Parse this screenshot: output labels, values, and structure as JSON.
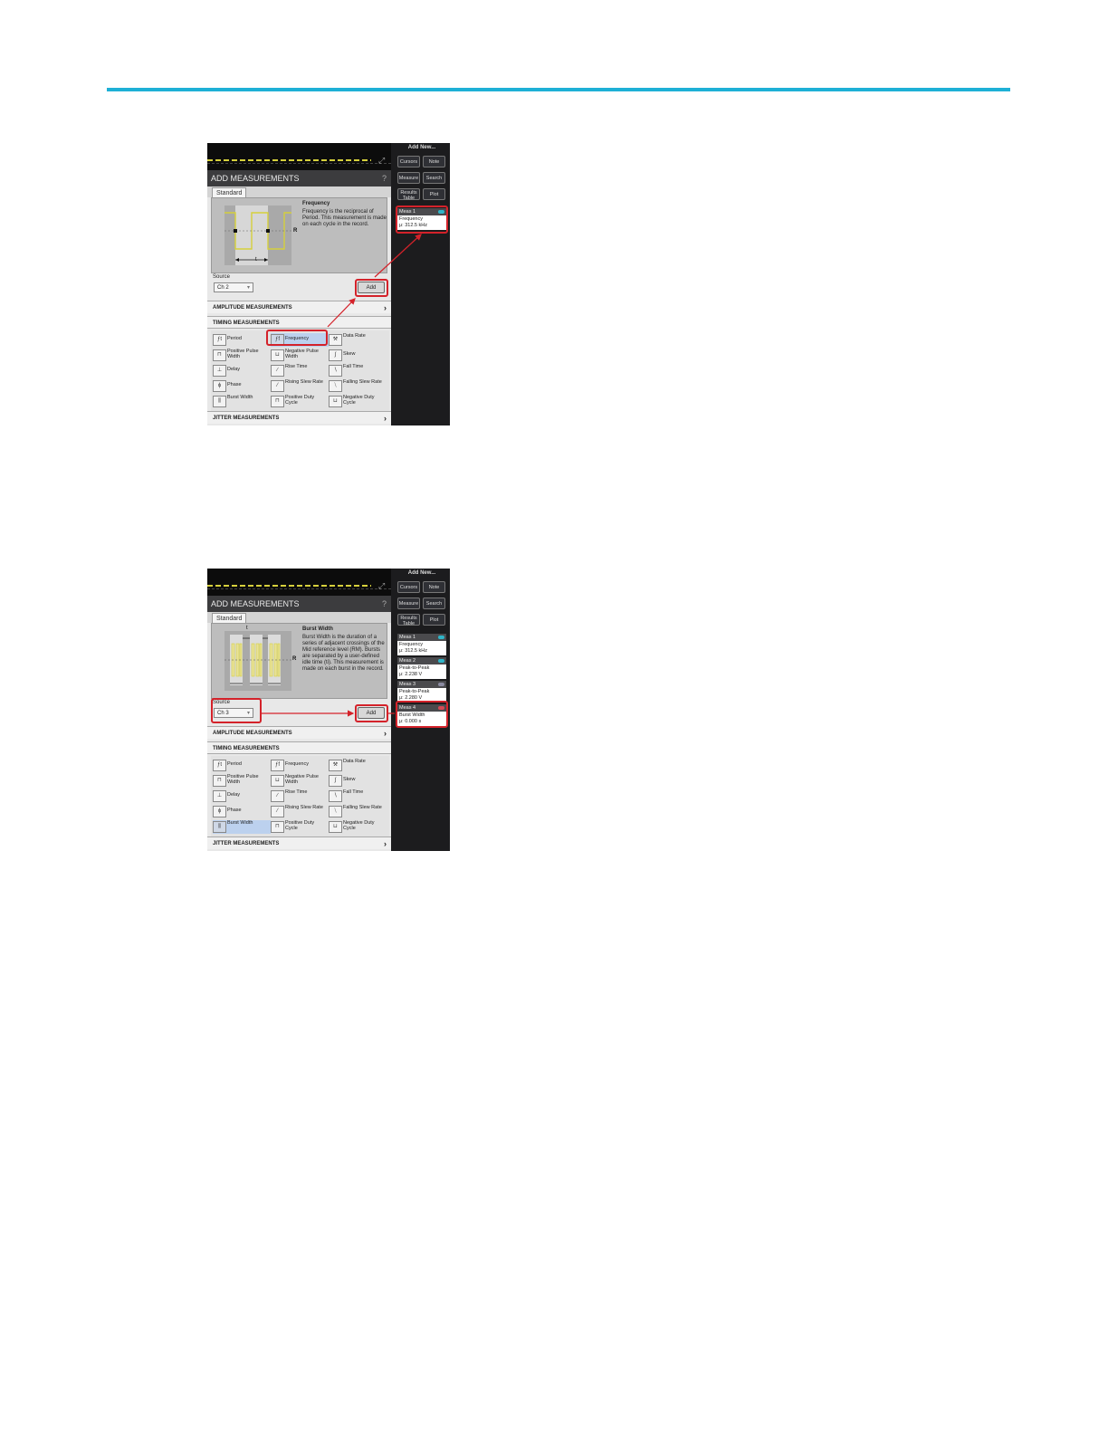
{
  "colors": {
    "rule": "#1eb0d6",
    "highlight": "#d4222a",
    "trace_yellow": "#d6d03c",
    "ch2_badge": "#2fb5c8",
    "ch3_badge": "#8a8aa0",
    "ch4_badge": "#d44a55"
  },
  "panel": {
    "title": "ADD MEASUREMENTS",
    "help": "?",
    "tab": "Standard",
    "source_label": "Source",
    "add_label": "Add",
    "amplitude_section": "AMPLITUDE MEASUREMENTS",
    "timing_section": "TIMING MEASUREMENTS",
    "jitter_section": "JITTER MEASUREMENTS",
    "items": [
      "Period",
      "Frequency",
      "Data Rate",
      "Positive Pulse Width",
      "Negative Pulse Width",
      "Skew",
      "Delay",
      "Rise Time",
      "Fall Time",
      "Phase",
      "Rising Slew Rate",
      "Falling Slew Rate",
      "Burst Width",
      "Positive Duty Cycle",
      "Negative Duty Cycle"
    ],
    "icon_names": [
      "period-icon",
      "frequency-icon",
      "data-rate-icon",
      "positive-pulse-width-icon",
      "negative-pulse-width-icon",
      "skew-icon",
      "delay-icon",
      "rise-time-icon",
      "fall-time-icon",
      "phase-icon",
      "rising-slew-rate-icon",
      "falling-slew-rate-icon",
      "burst-width-icon",
      "positive-duty-cycle-icon",
      "negative-duty-cycle-icon"
    ]
  },
  "side": {
    "add_new": "Add New...",
    "cursors": "Cursors",
    "note": "Note",
    "measure": "Measure",
    "search": "Search",
    "results_table_1": "Results",
    "results_table_2": "Table",
    "plot": "Plot"
  },
  "shot1": {
    "desc_title": "Frequency",
    "desc_text": "Frequency is the reciprocal of Period. This measurement is made on each cycle in the record.",
    "mid_label": "R",
    "t_label": "t",
    "source_value": "Ch 2",
    "selected_item": "Frequency",
    "meas": [
      {
        "name": "Meas 1",
        "type": "Frequency",
        "value": "μ: 312.5 kHz"
      }
    ]
  },
  "shot2": {
    "desc_title": "Burst Width",
    "desc_text": "Burst Width is the duration of a series of adjacent crossings of the Mid reference level (RM). Bursts are separated by a user-defined idle time (ti). This measurement is made on each burst in the record.",
    "mid_label": "R",
    "t_label": "t",
    "source_value": "Ch 3",
    "selected_item": "Burst Width",
    "meas": [
      {
        "name": "Meas 1",
        "type": "Frequency",
        "value": "μ: 312.5 kHz"
      },
      {
        "name": "Meas 2",
        "type": "Peak-to-Peak",
        "value": "μ: 2.238 V"
      },
      {
        "name": "Meas 3",
        "type": "Peak-to-Peak",
        "value": "μ: 2.280 V"
      },
      {
        "name": "Meas 4",
        "type": "Burst Width",
        "value": "μ: 0.000 s"
      }
    ]
  }
}
